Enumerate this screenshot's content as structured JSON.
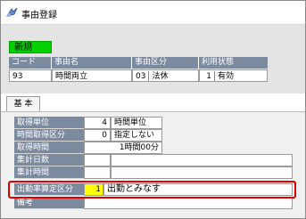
{
  "window": {
    "title": "事由登録",
    "icon": "app-icon"
  },
  "mode_badge": "新規",
  "header_table": {
    "columns": [
      "コード",
      "事由名",
      "事由区分",
      "利用状態"
    ],
    "row": {
      "code": "93",
      "name": "時間両立",
      "category_code": "03",
      "category_name": "法休",
      "status_code": "1",
      "status_name": "有効"
    }
  },
  "tabs": [
    "基 本"
  ],
  "fields": {
    "acquisition_unit": {
      "label": "取得単位",
      "code": "4",
      "text": "時間単位"
    },
    "hour_acquisition_type": {
      "label": "時間取得区分",
      "code": "0",
      "text": "指定しない"
    },
    "acquisition_time": {
      "label": "取得時間",
      "value": "1時間00分"
    },
    "total_days": {
      "label": "集計日数"
    },
    "total_time": {
      "label": "集計時間"
    },
    "attendance_rate_type": {
      "label": "出勤率算定区分",
      "code": "1",
      "text": "出勤とみなす"
    },
    "remarks": {
      "label": "備考"
    }
  },
  "colors": {
    "header_bg": "#7b8a9e",
    "badge_green": "#00d000",
    "highlight_red": "#e00000",
    "focus_yellow": "#ffff00"
  }
}
